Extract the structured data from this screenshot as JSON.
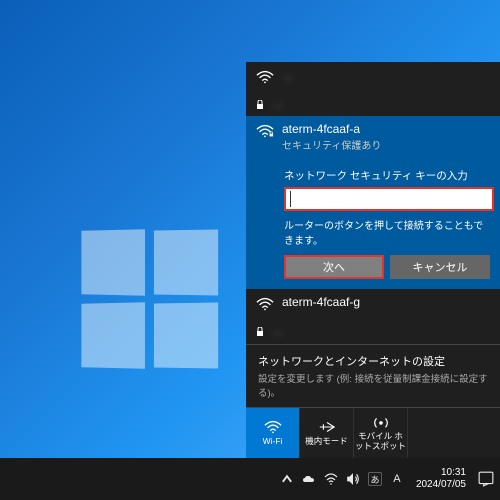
{
  "networks": {
    "n0": {
      "name": "…"
    },
    "n1": {
      "name": "…"
    },
    "selected": {
      "name": "aterm-4fcaaf-a",
      "status": "セキュリティ保護あり",
      "key_label": "ネットワーク セキュリティ キーの入力",
      "hint": "ルーターのボタンを押して接続することもできます。",
      "next": "次へ",
      "cancel": "キャンセル"
    },
    "n3": {
      "name": "aterm-4fcaaf-g"
    },
    "n4": {
      "name": "…"
    },
    "n5": {
      "name": "…"
    }
  },
  "settings": {
    "title": "ネットワークとインターネットの設定",
    "sub": "設定を変更します (例: 接続を従量制課金接続に設定する)。"
  },
  "tiles": {
    "wifi": "Wi-Fi",
    "airplane": "機内モード",
    "hotspot": "モバイル ホットスポット"
  },
  "tray": {
    "ime_mode": "あ",
    "ime_a": "A",
    "time": "10:31",
    "date": "2024/07/05"
  }
}
